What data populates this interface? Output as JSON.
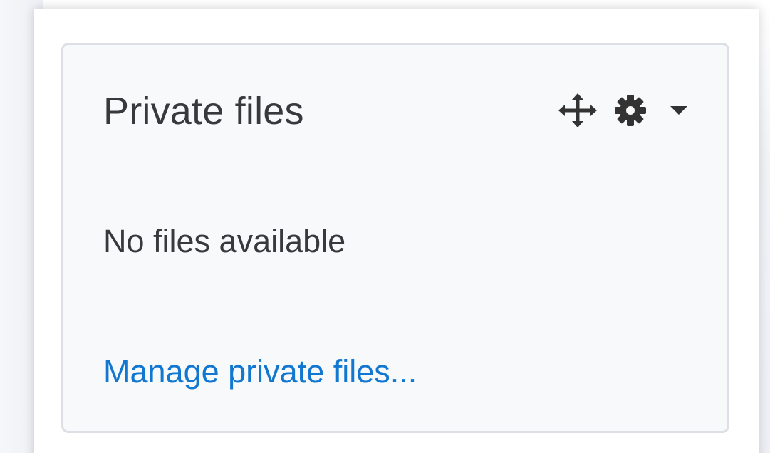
{
  "block": {
    "title": "Private files",
    "empty_message": "No files available",
    "manage_link": "Manage private files...",
    "controls": {
      "move_icon": "move-icon",
      "settings_icon": "gear-icon",
      "menu_icon": "caret-down-icon"
    }
  },
  "colors": {
    "text": "#373a3c",
    "link": "#1177d1",
    "card_background": "#f8f9fa",
    "card_border": "#dcdfe3"
  }
}
